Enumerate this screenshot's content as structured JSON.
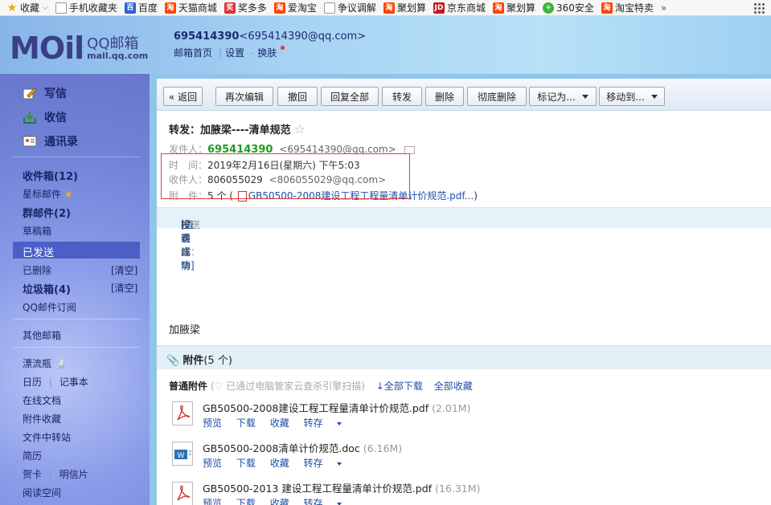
{
  "bookmarks": [
    {
      "icon": "star-icon",
      "label": "收藏",
      "has_caret": true
    },
    {
      "icon": "mobile-icon",
      "label": "手机收藏夹"
    },
    {
      "icon": "baidu-icon",
      "label": "百度"
    },
    {
      "icon": "taobao-icon",
      "label": "天猫商城"
    },
    {
      "icon": "jiang-icon",
      "label": "奖多多"
    },
    {
      "icon": "taobao-icon",
      "label": "爱淘宝"
    },
    {
      "icon": "document-icon",
      "label": "争议调解"
    },
    {
      "icon": "taobao-icon",
      "label": "聚划算"
    },
    {
      "icon": "jd-icon",
      "label": "京东商城"
    },
    {
      "icon": "taobao-icon",
      "label": "聚划算"
    },
    {
      "icon": "360-icon",
      "label": "360安全"
    },
    {
      "icon": "taobao-icon",
      "label": "淘宝特卖"
    }
  ],
  "bookmarks_more": "»",
  "header": {
    "logo_main": "MOil",
    "logo_qq": "QQ邮箱",
    "logo_url": "mail.qq.com",
    "account_name": "695414390",
    "account_email": "<695414390@qq.com>",
    "links": [
      "邮箱首页",
      "设置",
      "换肤"
    ]
  },
  "sidebar": {
    "compose": "写信",
    "inbox_top": "收信",
    "contacts": "通讯录",
    "folders": {
      "inbox": "收件箱(12)",
      "starred": "星标邮件",
      "group": "群邮件(2)",
      "drafts": "草稿箱",
      "sent": "已发送",
      "deleted": "已删除",
      "deleted_clear": "[清空]",
      "spam": "垃圾箱(4)",
      "spam_clear": "[清空]",
      "subscriptions": "QQ邮件订阅"
    },
    "other_mail": "其他邮箱",
    "apps": {
      "drift": "漂流瓶",
      "calendar": "日历",
      "notes": "记事本",
      "docs": "在线文档",
      "attach_fav": "附件收藏",
      "transfer": "文件中转站",
      "resume": "简历",
      "cards": "贺卡",
      "postcard": "明信片",
      "reading": "阅读空间"
    }
  },
  "toolbar": {
    "back": "« 返回",
    "reedit": "再次编辑",
    "recall": "撤回",
    "reply_all": "回复全部",
    "forward": "转发",
    "delete": "删除",
    "delete_perm": "彻底删除",
    "mark_as": "标记为...",
    "move_to": "移动到..."
  },
  "mail": {
    "subject": "转发：加腋梁----清单规范",
    "star": "☆",
    "from_label": "发件人：",
    "from_name": "695414390",
    "from_email": "<695414390@qq.com>",
    "time_label": "时　间：",
    "time_value": "2019年2月16日(星期六) 下午5:03",
    "to_label": "收件人：",
    "to_name": "806055029",
    "to_email": "<806055029@qq.com>",
    "attach_label": "附　件：",
    "attach_count": "5 个 (",
    "attach_first": "GB50500-2008建设工程工程量清单计价规范.pdf...",
    "attach_close": ")",
    "status_label": "发送状态：",
    "status_value": "投递成功",
    "status_link": "[查看详情]",
    "body_text": "加腋梁"
  },
  "attachments": {
    "section_title": "附件",
    "section_count": "(5 个)",
    "normal_label": "普通附件",
    "scan_note": "(♡ 已通过电脑管家云查杀引擎扫描)",
    "download_all": "全部下载",
    "save_all": "全部收藏",
    "files": [
      {
        "type": "pdf",
        "name": "GB50500-2008建设工程工程量清单计价规范.pdf",
        "size": "(2.01M)"
      },
      {
        "type": "doc",
        "name": "GB50500-2008清单计价规范.doc",
        "size": "(6.16M)"
      },
      {
        "type": "pdf",
        "name": "GB50500-2013 建设工程工程量清单计价规范.pdf",
        "size": "(16.31M)"
      }
    ],
    "actions": {
      "preview": "预览",
      "download": "下载",
      "favorite": "收藏",
      "forward": "转存"
    }
  }
}
